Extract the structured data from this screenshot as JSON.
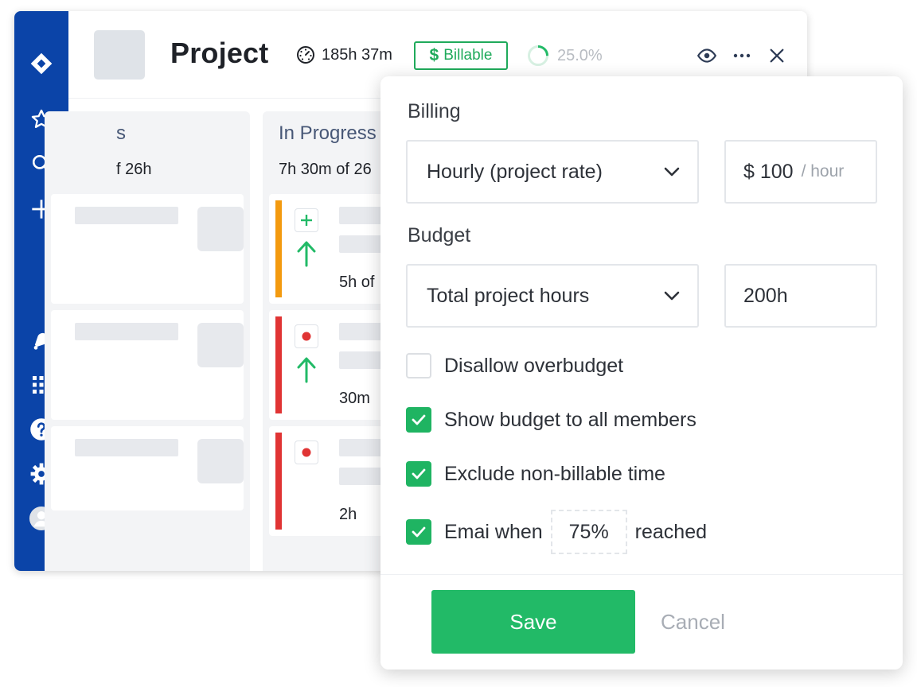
{
  "app": {
    "accent": "#0b44a8",
    "success": "#22ba67"
  },
  "sidebar": {
    "items": [
      {
        "icon": "logo-diamond-icon"
      },
      {
        "icon": "star-icon"
      },
      {
        "icon": "search-icon"
      },
      {
        "icon": "plus-icon"
      },
      {
        "icon": "bell-icon"
      },
      {
        "icon": "apps-grid-icon"
      },
      {
        "icon": "help-icon"
      },
      {
        "icon": "gear-icon"
      },
      {
        "icon": "user-avatar-icon"
      }
    ]
  },
  "header": {
    "title": "Project",
    "time_total": "185h 37m",
    "billable_symbol": "$",
    "billable_label": "Billable",
    "progress_label": "25.0%",
    "progress_fraction": 0.25
  },
  "board": {
    "columns": [
      {
        "title": "s",
        "subtitle": "f 26h",
        "cards": [
          {},
          {},
          {}
        ]
      },
      {
        "title": "In Progress",
        "subtitle": "7h 30m of 26",
        "cards": [
          {
            "priority_color": "#f39a0f",
            "icon": "plus-icon",
            "arrow": "arrow-up-icon",
            "time": "5h of"
          },
          {
            "priority_color": "#e03434",
            "icon": "dot-icon",
            "arrow": "arrow-up-icon",
            "time": "30m"
          },
          {
            "priority_color": "#e03434",
            "icon": "dot-icon",
            "arrow": "",
            "time": "2h"
          }
        ]
      }
    ]
  },
  "popup": {
    "billing_label": "Billing",
    "billing_type": "Hourly (project rate)",
    "rate_value": "$ 100",
    "rate_unit": "/ hour",
    "budget_label": "Budget",
    "budget_type": "Total project hours",
    "budget_value": "200h",
    "options": {
      "disallow_overbudget": {
        "label": "Disallow overbudget",
        "checked": false
      },
      "show_budget": {
        "label": "Show budget to all members",
        "checked": true
      },
      "exclude_nonbillable": {
        "label": "Exclude non-billable time",
        "checked": true
      },
      "email_when": {
        "label": "Emai when",
        "checked": true,
        "percent": "75%",
        "suffix": "reached"
      }
    },
    "save_label": "Save",
    "cancel_label": "Cancel"
  }
}
